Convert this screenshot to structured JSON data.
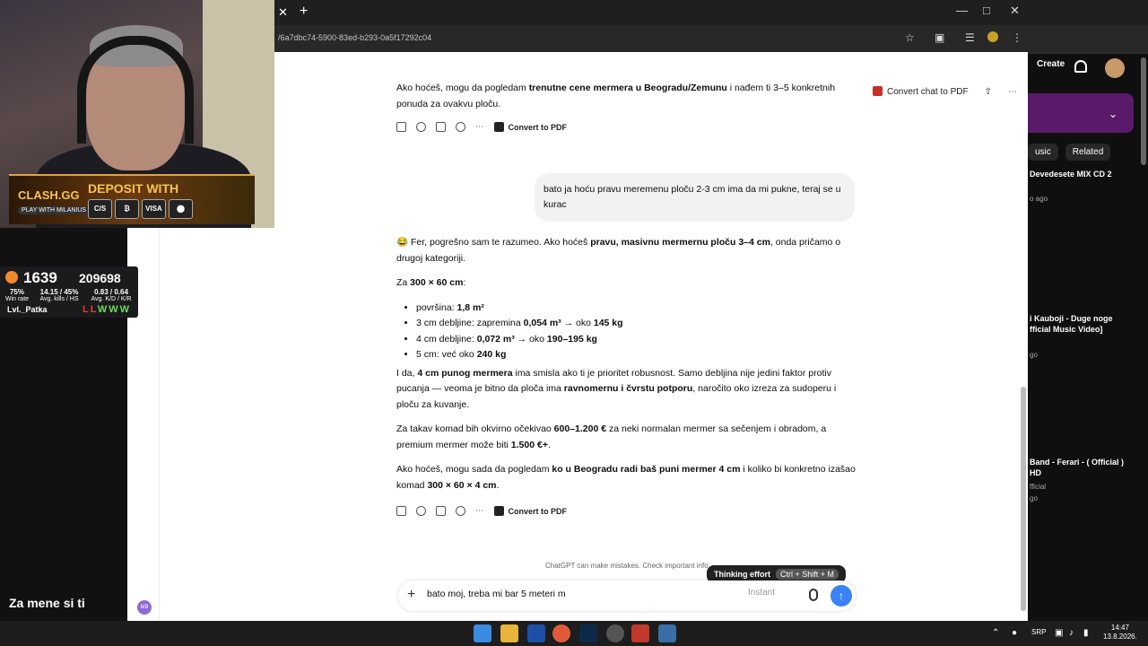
{
  "browser": {
    "url": "/6a7dbc74-5900-83ed-b293-0a5f17292c04"
  },
  "chat": {
    "header": {
      "convert_label": "Convert chat to PDF"
    },
    "prev_msg": {
      "p1_a": "Ako hoćeš, mogu da pogledam ",
      "p1_b": "trenutne cene mermera u Beogradu/Zemunu",
      "p1_c": " i nađem ti 3–5 konkretnih ponuda za ovakvu ploču."
    },
    "convert_pdf": "Convert to PDF",
    "user_msg": "bato ja hoću pravu meremenu ploču 2-3 cm ima da mi pukne, teraj se u kurac",
    "reply": {
      "intro_emoji": "😂",
      "intro_a": " Fer, pogrešno sam te razumeo. Ako hoćeš ",
      "intro_b": "pravu, masivnu mermernu ploču 3–4 cm",
      "intro_c": ", onda pričamo o drugoj kategoriji.",
      "dims_a": "Za ",
      "dims_b": "300 × 60 cm",
      "dims_c": ":",
      "bullets": [
        {
          "a": "površina: ",
          "b": "1,8 m²",
          "c": "",
          "d": ""
        },
        {
          "a": "3 cm debljine: zapremina ",
          "b": "0,054 m³",
          "c": " → oko ",
          "d": "145 kg"
        },
        {
          "a": "4 cm debljine: ",
          "b": "0,072 m³",
          "c": " → oko ",
          "d": "190–195 kg"
        },
        {
          "a": "5 cm: već oko ",
          "b": "240 kg",
          "c": "",
          "d": ""
        }
      ],
      "p2_a": "I da, ",
      "p2_b": "4 cm punog mermera",
      "p2_c": " ima smisla ako ti je prioritet robusnost. Samo debljina nije jedini faktor protiv pucanja — veoma je bitno da ploča ima ",
      "p2_d": "ravnomernu i čvrstu potporu",
      "p2_e": ", naročito oko izreza za sudoperu i ploču za kuvanje.",
      "p3_a": "Za takav komad bih okvirno očekivao ",
      "p3_b": "600–1.200 €",
      "p3_c": " za neki normalan mermer sa sečenjem i obradom, a premium mermer može biti ",
      "p3_d": "1.500 €+",
      "p3_e": ".",
      "p4_a": "Ako hoćeš, mogu sada da pogledam ",
      "p4_b": "ko u Beogradu radi baš puni mermer 4 cm",
      "p4_c": " i koliko bi konkretno izašao komad ",
      "p4_d": "300 × 60 × 4 cm",
      "p4_e": "."
    },
    "disclaimer": "ChatGPT can make mistakes. Check important info.",
    "tooltip": {
      "label": "Thinking effort",
      "shortcut": "Ctrl + Shift + M"
    },
    "composer": {
      "value": "bato moj, treba mi bar 5 meteri m",
      "effort": "Instant"
    }
  },
  "stream": {
    "banner": {
      "brand": "CLASH.GG",
      "sub": "PLAY WITH MILANIUS",
      "deposit": "DEPOSIT WITH",
      "chips": [
        "C/S",
        "₿",
        "VISA",
        "⬤"
      ]
    },
    "stats": {
      "elo": "1639",
      "points": "209698",
      "cells": [
        {
          "value": "75%",
          "label": "Win rate"
        },
        {
          "value": "14.15 / 45%",
          "label": "Avg. kills / HS"
        },
        {
          "value": "0.83 / 0.64",
          "label": "Avg. K/D / K/R"
        }
      ],
      "player": "Lvl._Patka",
      "results": [
        "L",
        "L",
        "W",
        "W",
        "W"
      ]
    },
    "caption": "Za mene si ti",
    "avatar": "MB"
  },
  "youtube": {
    "create": "Create",
    "pills": [
      "usic",
      "Related"
    ],
    "videos": [
      {
        "title": "Devedesete MIX CD 2",
        "meta": "o ago"
      },
      {
        "title": "i Kauboji - Duge noge fficial Music Video]",
        "meta": "go"
      },
      {
        "title": "Band - Ferari - ( Official ) HD",
        "meta": "fficial"
      }
    ],
    "meta_ago": "go"
  },
  "taskbar": {
    "lang": "SRP",
    "time": "14:47",
    "date": "13.8.2026."
  }
}
